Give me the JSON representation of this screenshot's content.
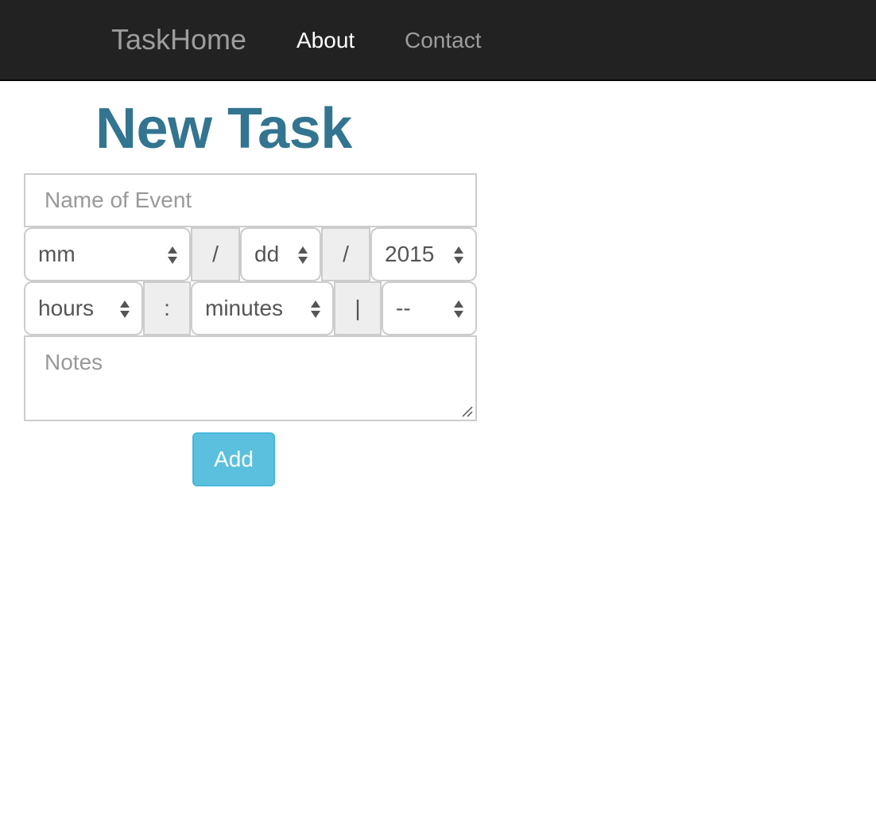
{
  "navbar": {
    "brand": "TaskHome",
    "links": [
      {
        "label": "About",
        "active": true
      },
      {
        "label": "Contact",
        "active": false
      }
    ]
  },
  "form": {
    "title": "New Task",
    "name_placeholder": "Name of Event",
    "date": {
      "month": "mm",
      "separator1": "/",
      "day": "dd",
      "separator2": "/",
      "year": "2015"
    },
    "time": {
      "hours": "hours",
      "separator": ":",
      "minutes": "minutes",
      "divider": "|",
      "ampm": "--"
    },
    "notes_placeholder": "Notes",
    "submit_label": "Add"
  },
  "colors": {
    "navbar_bg": "#222222",
    "title": "#337490",
    "button_bg": "#5bc0de"
  }
}
